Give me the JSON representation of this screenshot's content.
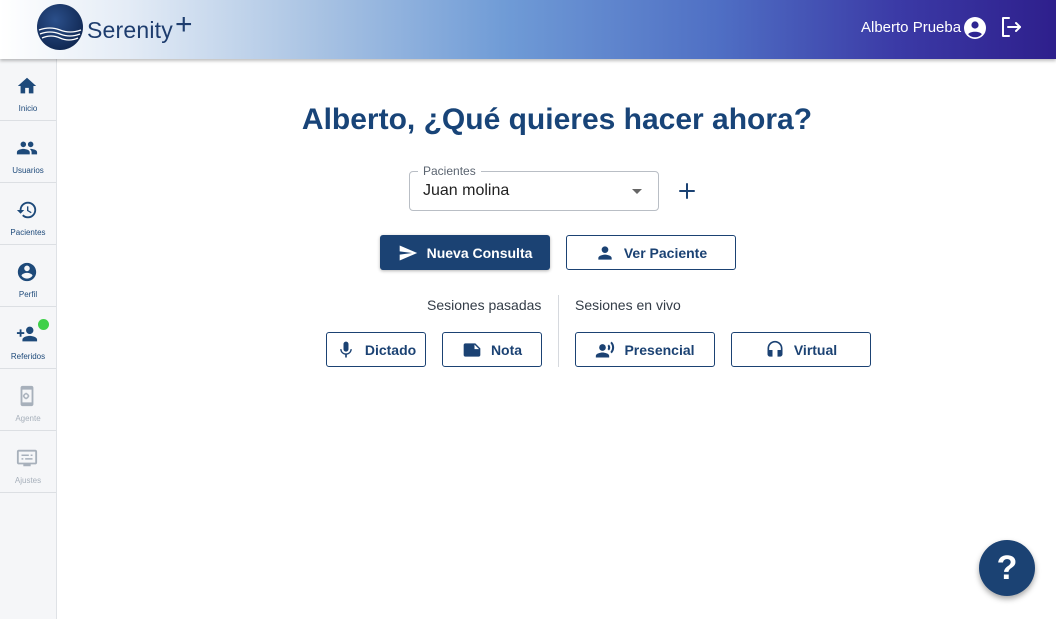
{
  "header": {
    "brand": "Serenity",
    "brand_plus": "+",
    "user_name": "Alberto Prueba"
  },
  "sidebar": {
    "items": [
      {
        "label": "Inicio",
        "icon": "home-icon"
      },
      {
        "label": "Usuarios",
        "icon": "users-icon"
      },
      {
        "label": "Pacientes",
        "icon": "history-icon"
      },
      {
        "label": "Perfil",
        "icon": "account-circle-icon"
      },
      {
        "label": "Referidos",
        "icon": "add-user-icon",
        "badge": true
      },
      {
        "label": "Agente",
        "icon": "phone-settings-icon",
        "disabled": true
      },
      {
        "label": "Ajustes",
        "icon": "monitor-settings-icon",
        "disabled": true
      }
    ]
  },
  "main": {
    "title": "Alberto, ¿Qué quieres hacer ahora?",
    "patient_select": {
      "label": "Pacientes",
      "value": "Juan molina"
    },
    "nueva_consulta_label": "Nueva Consulta",
    "ver_paciente_label": "Ver Paciente",
    "sesiones_pasadas": {
      "label": "Sesiones pasadas",
      "dictado_label": "Dictado",
      "nota_label": "Nota"
    },
    "sesiones_vivo": {
      "label": "Sesiones en vivo",
      "presencial_label": "Presencial",
      "virtual_label": "Virtual"
    },
    "help_label": "?"
  },
  "colors": {
    "primary": "#1b4273",
    "title": "#184478",
    "badge": "#3fd04a"
  }
}
